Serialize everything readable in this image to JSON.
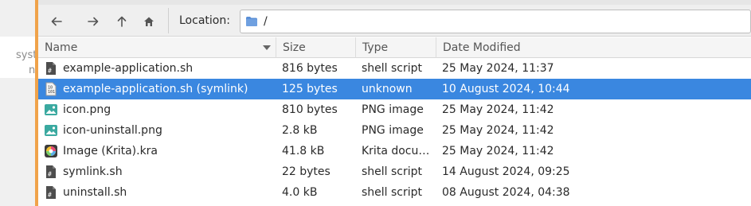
{
  "background_window": {
    "text_line1": "syst",
    "text_line2": "n"
  },
  "toolbar": {
    "back_icon": "arrow-left-icon",
    "forward_icon": "arrow-right-icon",
    "up_icon": "arrow-up-icon",
    "home_icon": "home-icon",
    "location_label": "Location:",
    "location_value": "/"
  },
  "columns": {
    "name": "Name",
    "size": "Size",
    "type": "Type",
    "date": "Date Modified"
  },
  "files": [
    {
      "name": "example-application.sh",
      "size": "816 bytes",
      "type": "shell script",
      "date": "25 May 2024, 11:37",
      "icon": "shell-script-icon",
      "selected": false
    },
    {
      "name": "example-application.sh (symlink)",
      "size": "125 bytes",
      "type": "unknown",
      "date": "10 August 2024, 10:44",
      "icon": "binary-file-icon",
      "selected": true
    },
    {
      "name": "icon.png",
      "size": "810 bytes",
      "type": "PNG image",
      "date": "25 May 2024, 11:42",
      "icon": "image-file-icon",
      "selected": false
    },
    {
      "name": "icon-uninstall.png",
      "size": "2.8 kB",
      "type": "PNG image",
      "date": "25 May 2024, 11:42",
      "icon": "image-file-icon",
      "selected": false
    },
    {
      "name": "Image (Krita).kra",
      "size": "41.8 kB",
      "type": "Krita docu…",
      "date": "25 May 2024, 11:42",
      "icon": "krita-file-icon",
      "selected": false
    },
    {
      "name": "symlink.sh",
      "size": "22 bytes",
      "type": "shell script",
      "date": "14 August 2024, 09:25",
      "icon": "shell-script-icon",
      "selected": false
    },
    {
      "name": "uninstall.sh",
      "size": "4.0 kB",
      "type": "shell script",
      "date": "08 August 2024, 04:38",
      "icon": "shell-script-icon",
      "selected": false
    }
  ],
  "colors": {
    "selection": "#3a87e0",
    "accent_edge": "#f0a34a",
    "folder": "#5a8fd6",
    "image_icon": "#3aa9a0"
  }
}
